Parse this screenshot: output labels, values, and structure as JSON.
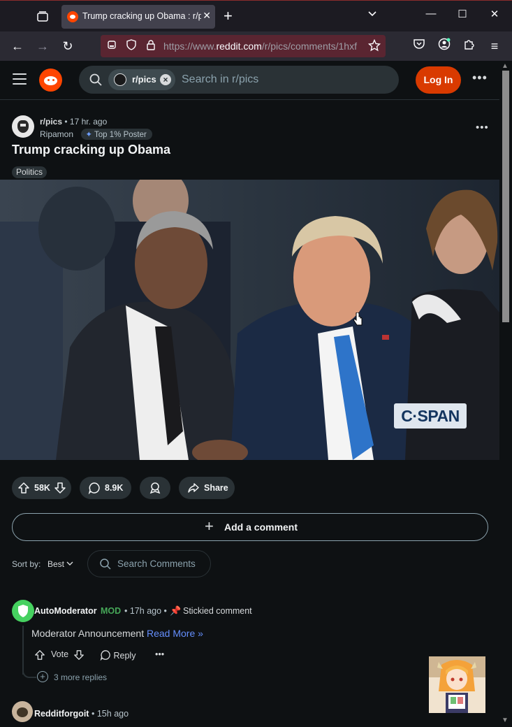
{
  "browser": {
    "tab_title": "Trump cracking up Obama : r/pics",
    "url_prefix": "https://www.",
    "url_host": "reddit.com",
    "url_path": "/r/pics/comments/1hxf"
  },
  "header": {
    "subreddit_chip": "r/pics",
    "search_placeholder": "Search in r/pics",
    "login_label": "Log In"
  },
  "post": {
    "subreddit": "r/pics",
    "time": "17 hr. ago",
    "author": "Ripamon",
    "author_flair": "Top 1% Poster",
    "title": "Trump cracking up Obama",
    "flair": "Politics",
    "watermark": "C·SPAN",
    "upvotes": "58K",
    "comments": "8.9K",
    "share_label": "Share"
  },
  "comments_section": {
    "add_comment_label": "Add a comment",
    "sort_label": "Sort by:",
    "sort_value": "Best",
    "search_placeholder": "Search Comments"
  },
  "comments": [
    {
      "author": "AutoModerator",
      "badge": "MOD",
      "time": "17h ago",
      "stickied": "Stickied comment",
      "body": "Moderator Announcement",
      "link": "Read More »",
      "vote_label": "Vote",
      "reply_label": "Reply",
      "more_replies": "3 more replies"
    },
    {
      "author": "Redditforgoit",
      "time": "15h ago"
    }
  ],
  "colors": {
    "accent": "#d93a00",
    "background": "#0e1113",
    "mod_green": "#46d160",
    "link_blue": "#648efc"
  }
}
